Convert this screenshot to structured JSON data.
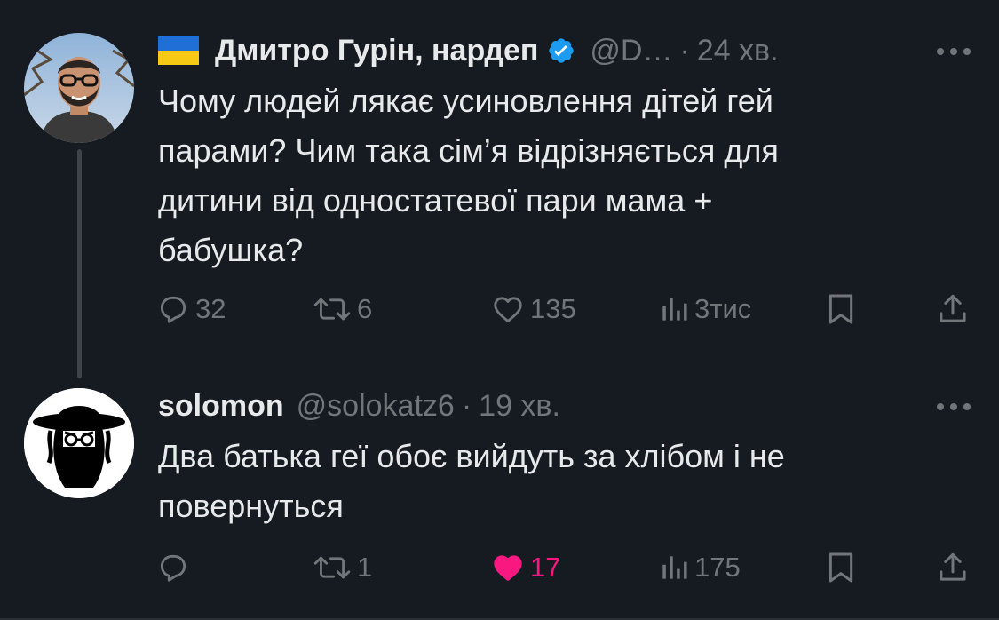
{
  "tweets": [
    {
      "flag_icon": "ukraine-flag-icon",
      "name": "Дмитро Гурін, нардеп",
      "verified": true,
      "verified_color": "#1d9bf0",
      "handle": "@D…",
      "dot": "·",
      "time": "24 хв.",
      "text": "Чому людей лякає усиновлення дітей гей\nпарами? Чим така сім’я відрізняється для\nдитини від одностатевої пари мама +\nбабушка?",
      "actions": {
        "replies": "32",
        "reposts": "6",
        "likes": "135",
        "views": "3тис"
      }
    },
    {
      "name": "solomon",
      "handle": "@solokatz6",
      "dot": "·",
      "time": "19 хв.",
      "text": "Два батька геї обоє вийдуть за хлібом і не\nповернуться",
      "actions": {
        "replies": "",
        "reposts": "1",
        "likes": "17",
        "liked": true,
        "like_color": "#f91880",
        "views": "175"
      }
    }
  ]
}
